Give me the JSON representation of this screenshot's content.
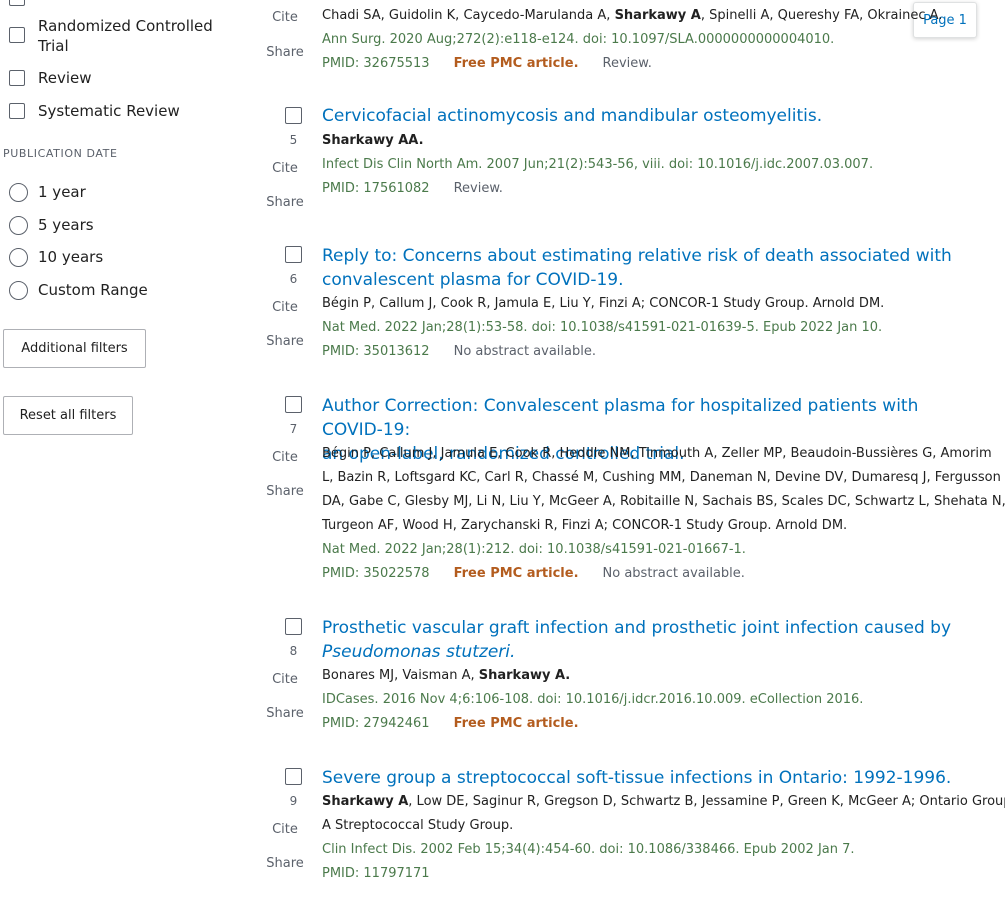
{
  "filters": {
    "article_types": [
      {
        "label": "Randomized Controlled Trial"
      },
      {
        "label": "Review"
      },
      {
        "label": "Systematic Review"
      }
    ],
    "publication_date_title": "PUBLICATION DATE",
    "dates": [
      {
        "label": "1 year"
      },
      {
        "label": "5 years"
      },
      {
        "label": "10 years"
      },
      {
        "label": "Custom Range"
      }
    ],
    "additional_filters": "Additional filters",
    "reset_filters": "Reset all filters"
  },
  "page_badge": "Page 1",
  "actions": {
    "cite": "Cite",
    "share": "Share"
  },
  "articles": [
    {
      "authors": [
        "Chadi SA, Guidolin K, Caycedo-Marulanda A, ",
        "Sharkawy A",
        ", Spinelli A, Quereshy FA, Okrainec A."
      ],
      "citation": "Ann Surg. 2020 Aug;272(2):e118-e124. doi: 10.1097/SLA.0000000000004010.",
      "pmid": "PMID: 32675513",
      "free": "Free PMC article.",
      "pubtype": "Review."
    },
    {
      "number": "5",
      "title": "Cervicofacial actinomycosis and mandibular osteomyelitis.",
      "authors_bold": "Sharkawy AA.",
      "citation": "Infect Dis Clin North Am. 2007 Jun;21(2):543-56, viii. doi: 10.1016/j.idc.2007.03.007.",
      "pmid": "PMID: 17561082",
      "pubtype": "Review."
    },
    {
      "number": "6",
      "title_lines": [
        "Reply to: Concerns about estimating relative risk of death associated with",
        "convalescent plasma for COVID-19."
      ],
      "authors": "Bégin P, Callum J, Cook R, Jamula E, Liu Y, Finzi A; CONCOR-1 Study Group. Arnold DM.",
      "citation": "Nat Med. 2022 Jan;28(1):53-58. doi: 10.1038/s41591-021-01639-5. Epub 2022 Jan 10.",
      "pmid": "PMID: 35013612",
      "pubtype": "No abstract available."
    },
    {
      "number": "7",
      "title_lines": [
        "Author Correction: Convalescent plasma for hospitalized patients with COVID-19:",
        "an open-label, randomized controlled trial."
      ],
      "author_lines": [
        "Bégin P, Callum J, Jamula E, Cook R, Heddle NM, Tinmouth A, Zeller MP, Beaudoin-Bussières G, Amorim",
        "L, Bazin R, Loftsgard KC, Carl R, Chassé M, Cushing MM, Daneman N, Devine DV, Dumaresq J, Fergusson",
        "DA, Gabe C, Glesby MJ, Li N, Liu Y, McGeer A, Robitaille N, Sachais BS, Scales DC, Schwartz L, Shehata N,",
        "Turgeon AF, Wood H, Zarychanski R, Finzi A; CONCOR-1 Study Group. Arnold DM."
      ],
      "citation": "Nat Med. 2022 Jan;28(1):212. doi: 10.1038/s41591-021-01667-1.",
      "pmid": "PMID: 35022578",
      "free": "Free PMC article.",
      "pubtype": "No abstract available."
    },
    {
      "number": "8",
      "title_lines": [
        "Prosthetic vascular graft infection and prosthetic joint infection caused by",
        "Pseudomonas stutzeri."
      ],
      "authors": [
        "Bonares MJ, Vaisman A, ",
        "Sharkawy A."
      ],
      "citation": "IDCases. 2016 Nov 4;6:106-108. doi: 10.1016/j.idcr.2016.10.009. eCollection 2016.",
      "pmid": "PMID: 27942461",
      "free": "Free PMC article."
    },
    {
      "number": "9",
      "title": "Severe group a streptococcal soft-tissue infections in Ontario: 1992-1996.",
      "author_lines": [
        "Sharkawy A",
        ", Low DE, Saginur R, Gregson D, Schwartz B, Jessamine P, Green K, McGeer A; Ontario Group",
        "A Streptococcal Study Group."
      ],
      "citation": "Clin Infect Dis. 2002 Feb 15;34(4):454-60. doi: 10.1086/338466. Epub 2002 Jan 7.",
      "pmid": "PMID: 11797171"
    }
  ]
}
